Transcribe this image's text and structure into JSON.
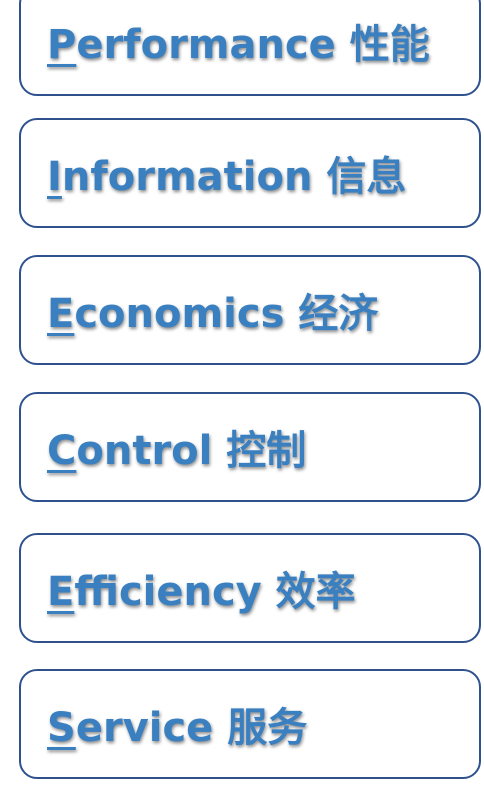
{
  "items": [
    {
      "initial": "P",
      "rest": "erformance 性能"
    },
    {
      "initial": "I",
      "rest": "nformation 信息"
    },
    {
      "initial": "E",
      "rest": "conomics 经济"
    },
    {
      "initial": "C",
      "rest": "ontrol 控制"
    },
    {
      "initial": "E",
      "rest": "fficiency 效率"
    },
    {
      "initial": "S",
      "rest": "ervice 服务"
    }
  ],
  "colors": {
    "text": "#3a7fbf",
    "border": "#2f528f"
  }
}
